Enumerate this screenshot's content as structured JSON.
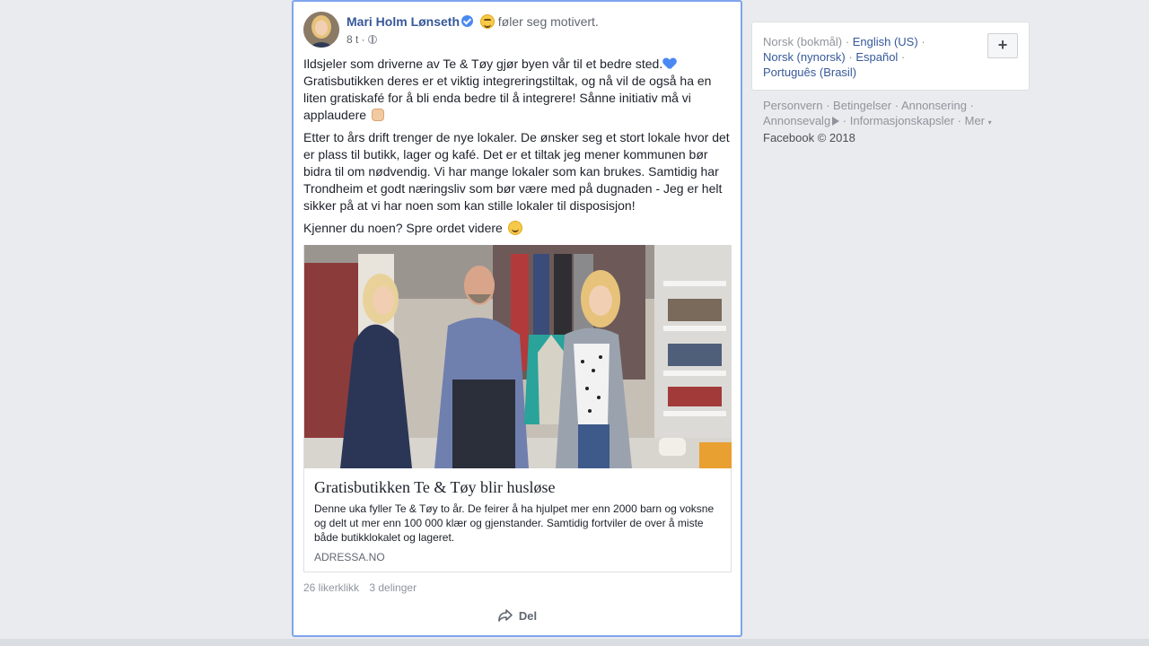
{
  "post": {
    "author": "Mari Holm Lønseth",
    "feeling": "føler seg motivert.",
    "time": "8 t ·",
    "paragraphs": [
      "Ildsjeler som driverne av Te & Tøy gjør byen vår til et bedre sted.",
      "Gratisbutikken deres er et viktig integreringstiltak, og nå vil de også ha en liten gratiskafé for å bli enda bedre til å integrere! Sånne initiativ må vi applaudere",
      "Etter to års drift trenger de nye lokaler. De ønsker seg et stort lokale hvor det er plass til butikk, lager og kafé. Det er et tiltak jeg mener kommunen bør bidra til om nødvendig. Vi har mange lokaler som kan brukes. Samtidig har Trondheim et godt næringsliv som bør være med på dugnaden - Jeg er helt sikker på at vi har noen som kan stille lokaler til disposisjon!",
      "Kjenner du noen? Spre ordet videre"
    ],
    "link": {
      "title": "Gratisbutikken Te & Tøy blir husløse",
      "description": "Denne uka fyller Te & Tøy to år. De feirer å ha hjulpet mer enn 2000 barn og voksne og delt ut mer enn 100 000 klær og gjenstander. Samtidig fortviler de over å miste både butikklokalet og lageret.",
      "domain": "ADRESSA.NO"
    },
    "likes": "26 likerklikk",
    "shares": "3 delinger",
    "share_label": "Del"
  },
  "languages": {
    "current": "Norsk (bokmål)",
    "english": "English (US)",
    "nynorsk": "Norsk (nynorsk)",
    "spanish": "Español",
    "portuguese": "Português (Brasil)",
    "add": "+"
  },
  "footer": {
    "privacy": "Personvern",
    "terms": "Betingelser",
    "advertising": "Annonsering",
    "ad_choices": "Annonsevalg",
    "cookies": "Informasjonskapsler",
    "more": "Mer",
    "copyright": "Facebook © 2018"
  },
  "colors": {
    "link_blue": "#365899",
    "verified_blue": "#4a89f3",
    "background": "#e9ebee"
  },
  "icons": [
    "verified-icon",
    "feeling-emoji-icon",
    "globe-icon",
    "heart-icon",
    "clap-icon",
    "smile-icon",
    "share-icon",
    "ad-choices-icon"
  ]
}
